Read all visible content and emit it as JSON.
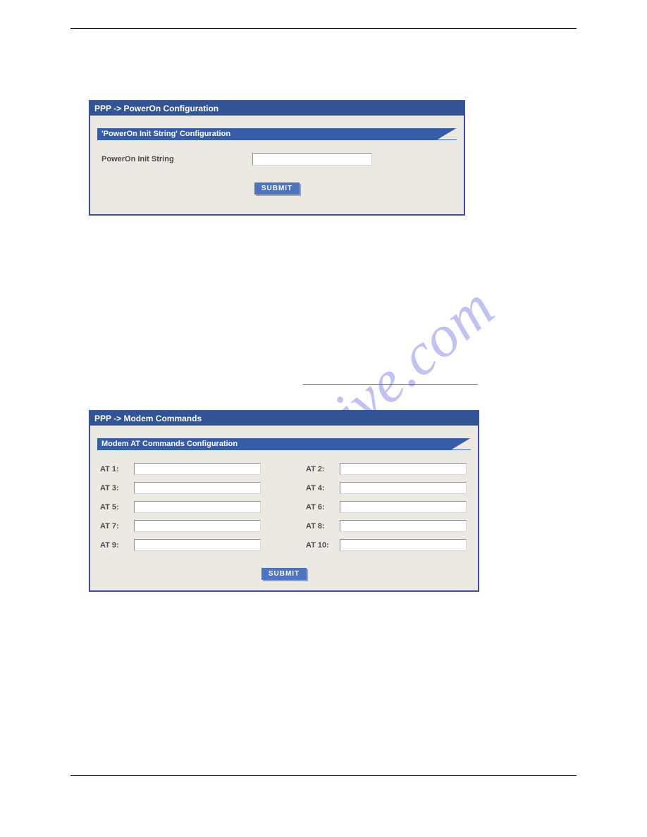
{
  "watermark": "manualshive.com",
  "panel1": {
    "breadcrumb": "PPP -> PowerOn Configuration",
    "section_title": "'PowerOn Init String' Configuration",
    "field_label": "PowerOn Init String",
    "field_value": "",
    "submit_label": "SUBMIT"
  },
  "panel2": {
    "breadcrumb": "PPP -> Modem Commands",
    "section_title": "Modem AT Commands Configuration",
    "submit_label": "SUBMIT",
    "at": [
      {
        "label": "AT 1:",
        "value": ""
      },
      {
        "label": "AT 2:",
        "value": ""
      },
      {
        "label": "AT 3:",
        "value": ""
      },
      {
        "label": "AT 4:",
        "value": ""
      },
      {
        "label": "AT 5:",
        "value": ""
      },
      {
        "label": "AT 6:",
        "value": ""
      },
      {
        "label": "AT 7:",
        "value": ""
      },
      {
        "label": "AT 8:",
        "value": ""
      },
      {
        "label": "AT 9:",
        "value": ""
      },
      {
        "label": "AT 10:",
        "value": ""
      }
    ]
  }
}
